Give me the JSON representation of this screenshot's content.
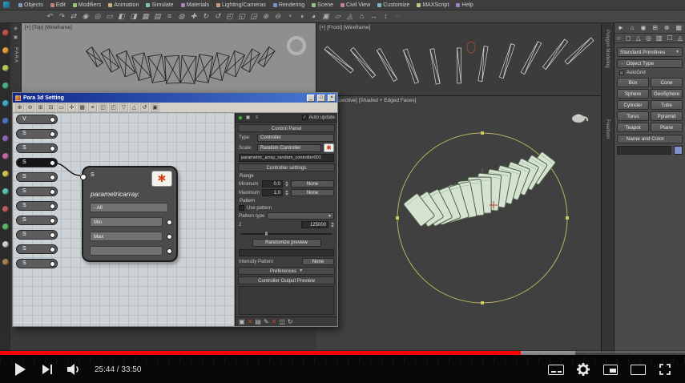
{
  "glyphs": {
    "check": "✓",
    "dropdown_arrow": "▼",
    "minus": "−",
    "asterisk_icon": "✱",
    "minimize": "_",
    "maximize": "□",
    "close": "×"
  },
  "player": {
    "time_display": "25:44 / 33:50",
    "progress_percent": 76,
    "buffer_percent": 84,
    "progress_color": "#ff0000"
  },
  "menubar": {
    "items": [
      "Objects",
      "Edit",
      "Modifiers",
      "Animation",
      "Simulate",
      "Materials",
      "Lighting/Cameras",
      "Rendering",
      "Scene",
      "Civil View",
      "Customize",
      "MAXScript",
      "Help"
    ]
  },
  "viewports": {
    "top_label": "[+] [Top] [Wireframe]",
    "front_label": "[+] [Front] [Wireframe]",
    "persp_label": "[+] [Perspective] [Shaded + Edged Faces]"
  },
  "ribbon": {
    "tabs": [
      "Polygon Modeling",
      "Freeform"
    ]
  },
  "command_panel": {
    "category_dropdown": "Standard Primitives",
    "object_type_rollout": "Object Type",
    "autogrid_label": "AutoGrid",
    "buttons": [
      "Box",
      "Cone",
      "Sphere",
      "GeoSphere",
      "Cylinder",
      "Tube",
      "Torus",
      "Pyramid",
      "Teapot",
      "Plane"
    ],
    "name_color_rollout": "Name and Color"
  },
  "para3d": {
    "window_title": "Para 3d Setting",
    "dock_label": "PARA",
    "node_pills": [
      "V",
      "S",
      "S",
      "S",
      "S",
      "S",
      "S",
      "S",
      "S",
      "S",
      "S"
    ],
    "selected_pill": 3,
    "node": {
      "title": "parametricarray.",
      "input_label": "S",
      "rows": [
        "- All",
        "Min",
        "Max",
        ""
      ]
    },
    "panel": {
      "auto_update": "Auto update",
      "title": "Control Panel",
      "type_label": "Type:",
      "type_value": "Controller",
      "scale_label": "Scale:",
      "scale_value": "Random Controller",
      "name_field": "parametric_array_randam_controller001",
      "settings_header": "Controller settings",
      "range_label": "Range",
      "minimum_label": "Minimum",
      "maximum_label": "Maximum",
      "min_value": "0.0",
      "max_value": "1.0",
      "none_label": "None",
      "pattern_label": "Pattern",
      "use_pattern_label": "Use pattern",
      "pattern_type_label": "Pattern type",
      "pattern_count": "2",
      "seed_value": "125000",
      "randomize_button": "Randomize preview",
      "intensity_label": "Intensity Pattern",
      "preferences_label": "Preferences",
      "output_header": "Controller Output Preview"
    }
  },
  "decor": {
    "left_strip_colors": [
      "#c1504c",
      "#e09a3c",
      "#b5c95a",
      "#4fae85",
      "#3fa9c9",
      "#4f74c1",
      "#8a65b5",
      "#c465a8",
      "#d1c44e",
      "#5ac1b0",
      "#b85c5c",
      "#5cb86a",
      "#cfcfcf",
      "#a8824f"
    ],
    "menu_icon_colors": [
      "#7f9cc4",
      "#c47f7f",
      "#9cc47f",
      "#c4b27f",
      "#7fc4b8",
      "#b27fc4",
      "#c49c7f",
      "#7f8ec4",
      "#8ec47f",
      "#c47fa6",
      "#7fb8c4",
      "#c4c47f",
      "#9c7fc4"
    ],
    "main_toolbar_glyphs": [
      "↶",
      "↷",
      "⇄",
      "◉",
      "◎",
      "▭",
      "◧",
      "◨",
      "▦",
      "▤",
      "≡",
      "◍",
      "✚",
      "↻",
      "↺",
      "◰",
      "◱",
      "◲",
      "⊕",
      "⊖",
      "◔",
      "◑",
      "◕",
      "▣",
      "▱",
      "◬",
      "⌂",
      "↔",
      "↕",
      "◌"
    ],
    "para_toolbar_glyphs": [
      "⊕",
      "⊖",
      "⊞",
      "⊟",
      "▭",
      "✛",
      "▦",
      "≡",
      "◫",
      "◰",
      "▽",
      "△",
      "↺",
      "▣"
    ],
    "cmd_tab_glyphs": [
      "►",
      "⌂",
      "◉",
      "⊞",
      "⊕",
      "▦"
    ],
    "cmd_sub_glyphs": [
      "○",
      "◻",
      "△",
      "◎",
      "▥",
      "☐",
      "◬"
    ],
    "panel_top_glyphs": [
      "▣",
      "≡"
    ],
    "panel_bottom_glyphs": [
      "▣",
      "✕",
      "▤",
      "✎",
      "✕",
      "◫",
      "↻"
    ],
    "dock_glyphs": [
      "◈",
      "▣"
    ]
  }
}
